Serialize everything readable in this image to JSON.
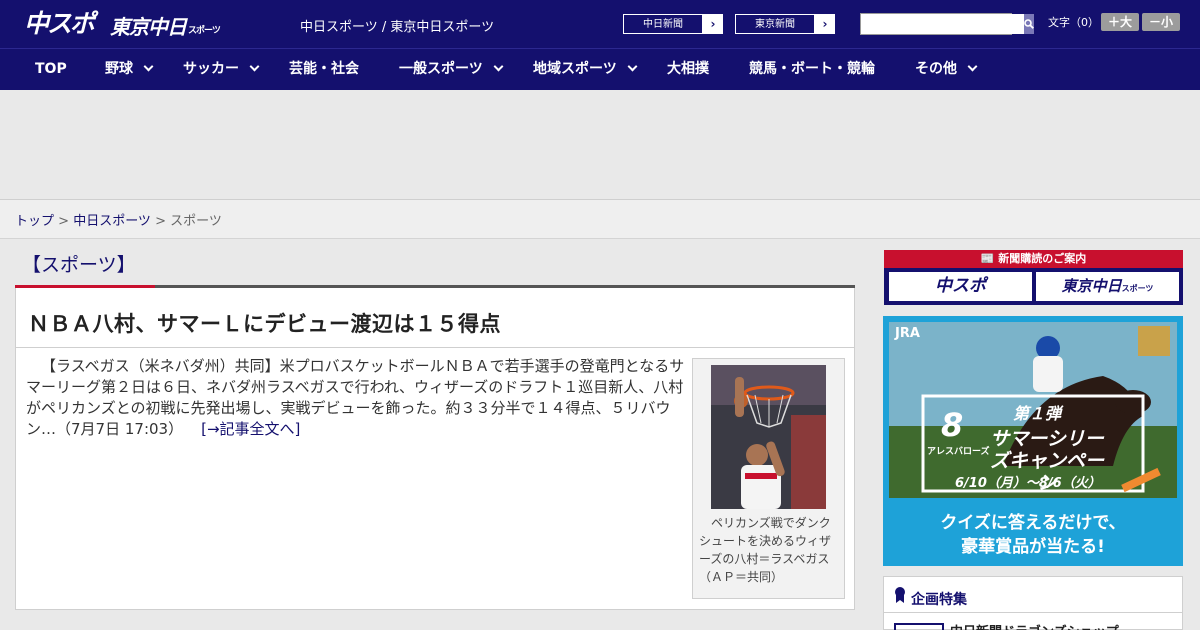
{
  "header": {
    "logo_chuspo": "中スポ",
    "logo_tokyo": "東京中日",
    "logo_tokyo_sub": "スポーツ",
    "site_names": "中日スポーツ / 東京中日スポーツ",
    "paper_links": [
      "中日新聞",
      "東京新聞"
    ],
    "search": {
      "placeholder": "",
      "icon": "search-icon"
    },
    "font_size": {
      "label": "文字（0）",
      "bigger": "＋大",
      "smaller": "－小"
    },
    "colors": {
      "brand": "#14106e",
      "accent": "#c8102e"
    }
  },
  "nav": {
    "items": [
      {
        "label": "TOP"
      },
      {
        "label": "野球"
      },
      {
        "label": "サッカー"
      },
      {
        "label": "芸能・社会"
      },
      {
        "label": "一般スポーツ"
      },
      {
        "label": "地域スポーツ"
      },
      {
        "label": "大相撲"
      },
      {
        "label": "競馬・ボート・競輪"
      },
      {
        "label": "その他"
      }
    ]
  },
  "breadcrumb": {
    "items": [
      "トップ",
      "中日スポーツ",
      "スポーツ"
    ],
    "sep": " > "
  },
  "main": {
    "section_title": "【スポーツ】",
    "headline": "ＮＢＡ八村、サマーＬにデビュー渡辺は１５得点",
    "body": "【ラスベガス（米ネバダ州）共同】米プロバスケットボールＮＢＡで若手選手の登竜門となるサマーリーグ第２日は６日、ネバダ州ラスベガスで行われ、ウィザーズのドラフト１巡目新人、八村がペリカンズとの初戦に先発出場し、実戦デビューを飾った。約３３分半で１４得点、５リバウン…（7月7日 17:03）",
    "read_more": "[→記事全文へ]",
    "photo_caption": "ペリカンズ戦でダンクシュートを決めるウィザーズの八村＝ラスベガス（ＡＰ＝共同）"
  },
  "sidebar": {
    "subscribe_title": "新聞購読のご案内",
    "subscribe_chuspo": "中スポ",
    "subscribe_tokyo": "東京中日",
    "subscribe_tokyo_sub": "スポーツ",
    "ad": {
      "brand": "JRA",
      "number": "8",
      "horse_name": "アレスバローズ",
      "series_no": "第１弾",
      "campaign": "サマーシリーズキャンペーン",
      "period": "6/10（月）～8/6（火）",
      "tagline1": "クイズに答えるだけで、",
      "tagline2": "豪華賞品が当たる!"
    },
    "kikaku_title": "企画特集",
    "kikaku_item": "中日新聞ドラゴンズショップ"
  }
}
